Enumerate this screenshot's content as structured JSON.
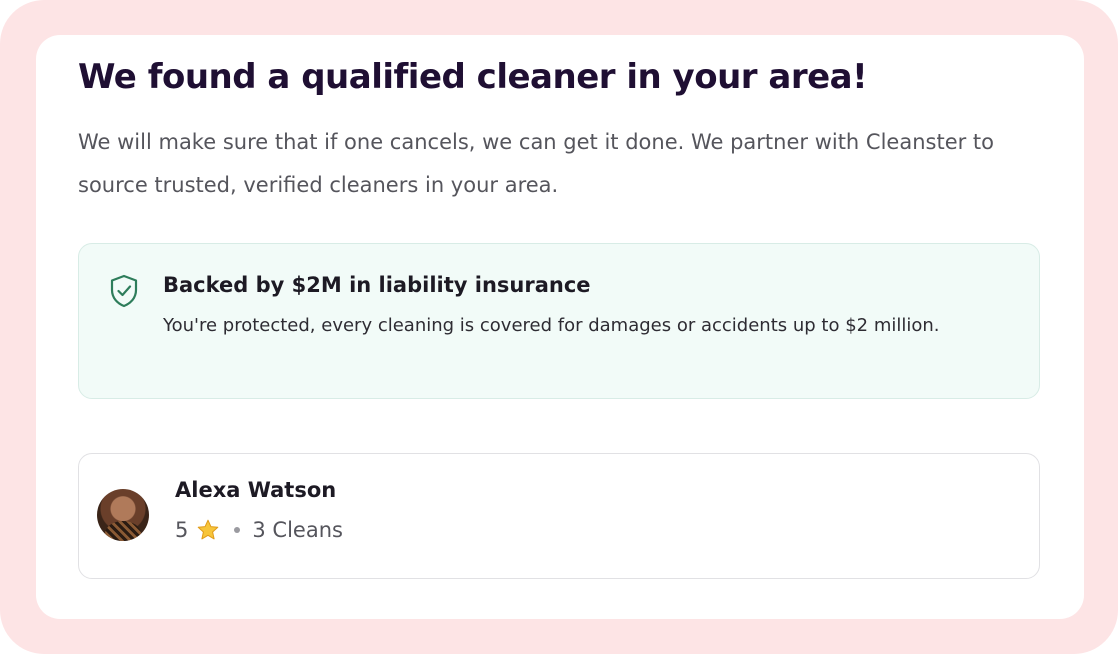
{
  "header": {
    "title": "We found a qualified cleaner in your area!",
    "subtitle": "We will make sure that if one cancels, we can get it done. We partner with Cleanster to source trusted, verified cleaners in your area."
  },
  "insurance": {
    "icon": "shield-check-icon",
    "title": "Backed by $2M in liability insurance",
    "description": "You're protected, every cleaning is covered for damages or accidents up to $2 million."
  },
  "cleaner": {
    "name": "Alexa Watson",
    "rating": "5",
    "rating_icon": "star-icon",
    "cleans": "3 Cleans"
  },
  "colors": {
    "frame": "#fde4e5",
    "title": "#1f0f33",
    "accent_green": "#2e7d5b",
    "insurance_bg": "#f2fbf8",
    "star": "#f5b82e"
  }
}
